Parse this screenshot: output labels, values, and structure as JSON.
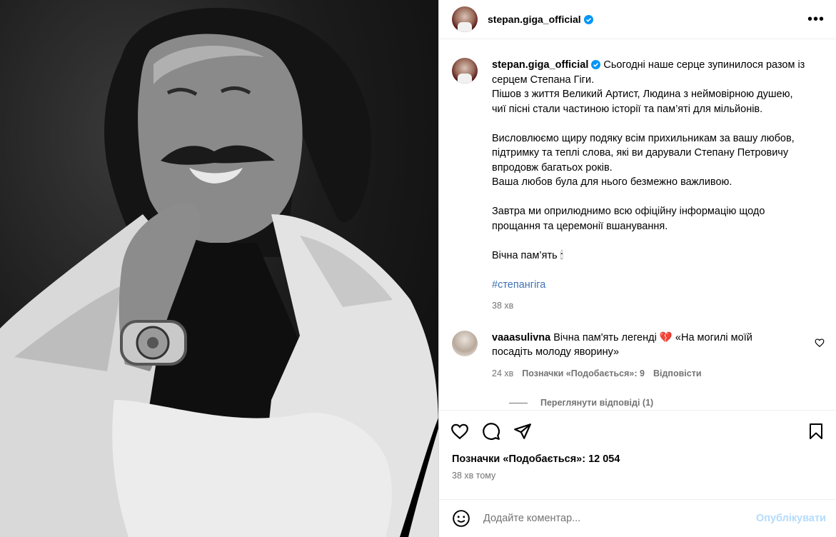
{
  "post": {
    "username": "stepan.giga_official",
    "verified_icon": "verified-badge-icon",
    "more_icon": "more-options-icon"
  },
  "caption": {
    "lines": [
      "Сьогодні наше серце зупинилося разом із",
      "серцем Степана Гіги.",
      "Пішов з життя Великий Артист, Людина з неймовірною душею,",
      "чиї пісні стали частиною історії та пам’яті для мільйонів.",
      "",
      "Висловлюємо щиру подяку всім прихильникам за вашу любов,",
      "підтримку та теплі слова, які ви дарували Степану Петровичу",
      "впродовж багатьох років.",
      "Ваша любов була для нього безмежно важливою.",
      "",
      "Завтра ми оприлюднимо всю офіційну інформацію щодо",
      "прощання та церемонії вшанування.",
      "",
      "Вічна пам’ять 🕯"
    ],
    "hashtag": "#степангіга",
    "time": "38 хв"
  },
  "comment": {
    "username": "vaaasulivna",
    "text": "Вічна пам'ять легенді 💔  «На могилі моїй посадіть молоду яворину»",
    "time": "24 хв",
    "likes": "Позначки «Подобається»: 9",
    "reply": "Відповісти",
    "view_replies": "Переглянути відповіді (1)"
  },
  "actions": {
    "likes": "Позначки «Подобається»: 12 054",
    "posted": "38 хв тому"
  },
  "add_comment": {
    "placeholder": "Додайте коментар...",
    "publish": "Опублікувати"
  }
}
